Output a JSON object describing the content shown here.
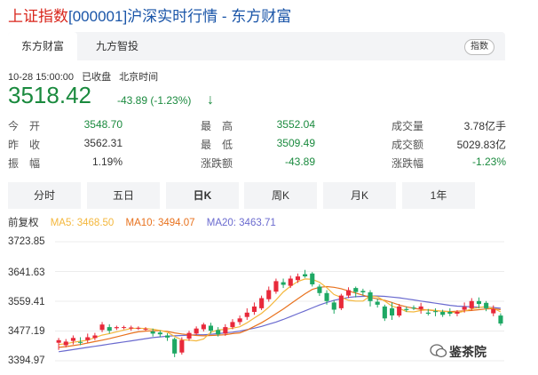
{
  "header": {
    "title_prefix": "上证指数",
    "title_code": "[000001]",
    "title_suffix": "沪深实时行情 - 东方财富"
  },
  "tabs": [
    {
      "label": "东方财富",
      "active": true
    },
    {
      "label": "九方智投",
      "active": false
    }
  ],
  "tag": "指数",
  "status": {
    "datetime": "10-28 15:00:00",
    "state": "已收盘",
    "tz": "北京时间"
  },
  "quote": {
    "price": "3518.42",
    "change": "-43.89 (-1.23%)",
    "arrow": "↓"
  },
  "stats": [
    {
      "label": "今　开",
      "value": "3548.70",
      "color": "g"
    },
    {
      "label": "最　高",
      "value": "3552.04",
      "color": "g"
    },
    {
      "label": "成交量",
      "value": "3.78亿手",
      "color": "k"
    },
    {
      "label": "昨　收",
      "value": "3562.31",
      "color": "k"
    },
    {
      "label": "最　低",
      "value": "3509.49",
      "color": "g"
    },
    {
      "label": "成交额",
      "value": "5029.83亿",
      "color": "k"
    },
    {
      "label": "振　幅",
      "value": "1.19%",
      "color": "k"
    },
    {
      "label": "涨跌额",
      "value": "-43.89",
      "color": "g"
    },
    {
      "label": "涨跌幅",
      "value": "-1.23%",
      "color": "g"
    }
  ],
  "periods": [
    {
      "label": "分时",
      "active": false
    },
    {
      "label": "五日",
      "active": false
    },
    {
      "label": "日K",
      "active": true
    },
    {
      "label": "周K",
      "active": false
    },
    {
      "label": "月K",
      "active": false
    },
    {
      "label": "1年",
      "active": false
    }
  ],
  "ma_legend": {
    "prefix": "前复权",
    "ma5": "MA5: 3468.50",
    "ma10": "MA10: 3494.07",
    "ma20": "MA20: 3463.71"
  },
  "colors": {
    "up": "#e8293a",
    "down": "#1ea864",
    "ma5": "#f4b73c",
    "ma10": "#e8721e",
    "ma20": "#6a6acf"
  },
  "watermark": "鉴茶院",
  "chart_data": {
    "type": "candlestick",
    "y_ticks": [
      "3723.85",
      "3641.63",
      "3559.41",
      "3477.19",
      "3394.97"
    ],
    "ylim": [
      3394.97,
      3723.85
    ],
    "grid": true,
    "candles": [
      [
        3445,
        3452,
        3425,
        3458
      ],
      [
        3438,
        3448,
        3432,
        3455
      ],
      [
        3450,
        3458,
        3440,
        3465
      ],
      [
        3447,
        3445,
        3438,
        3460
      ],
      [
        3452,
        3460,
        3445,
        3470
      ],
      [
        3458,
        3465,
        3452,
        3472
      ],
      [
        3480,
        3495,
        3474,
        3502
      ],
      [
        3488,
        3478,
        3470,
        3496
      ],
      [
        3485,
        3488,
        3480,
        3492
      ],
      [
        3486,
        3488,
        3482,
        3492
      ],
      [
        3484,
        3487,
        3478,
        3492
      ],
      [
        3484,
        3486,
        3480,
        3490
      ],
      [
        3482,
        3483,
        3478,
        3488
      ],
      [
        3476,
        3470,
        3462,
        3484
      ],
      [
        3473,
        3468,
        3460,
        3479
      ],
      [
        3465,
        3459,
        3450,
        3471
      ],
      [
        3455,
        3415,
        3405,
        3459
      ],
      [
        3418,
        3452,
        3412,
        3460
      ],
      [
        3456,
        3472,
        3450,
        3478
      ],
      [
        3470,
        3484,
        3466,
        3490
      ],
      [
        3482,
        3495,
        3476,
        3500
      ],
      [
        3492,
        3478,
        3470,
        3500
      ],
      [
        3480,
        3468,
        3462,
        3488
      ],
      [
        3470,
        3488,
        3464,
        3496
      ],
      [
        3488,
        3502,
        3482,
        3510
      ],
      [
        3502,
        3512,
        3494,
        3520
      ],
      [
        3516,
        3528,
        3508,
        3540
      ],
      [
        3530,
        3545,
        3522,
        3556
      ],
      [
        3540,
        3568,
        3535,
        3575
      ],
      [
        3565,
        3590,
        3558,
        3600
      ],
      [
        3586,
        3615,
        3580,
        3622
      ],
      [
        3612,
        3605,
        3596,
        3622
      ],
      [
        3602,
        3622,
        3596,
        3630
      ],
      [
        3618,
        3628,
        3610,
        3636
      ],
      [
        3634,
        3628,
        3624,
        3646
      ],
      [
        3636,
        3606,
        3600,
        3640
      ],
      [
        3600,
        3582,
        3574,
        3606
      ],
      [
        3582,
        3560,
        3550,
        3590
      ],
      [
        3556,
        3536,
        3525,
        3562
      ],
      [
        3540,
        3575,
        3535,
        3580
      ],
      [
        3575,
        3590,
        3568,
        3598
      ],
      [
        3596,
        3585,
        3570,
        3600
      ],
      [
        3588,
        3584,
        3575,
        3594
      ],
      [
        3584,
        3560,
        3545,
        3590
      ],
      [
        3558,
        3550,
        3542,
        3566
      ],
      [
        3545,
        3512,
        3505,
        3550
      ],
      [
        3540,
        3520,
        3508,
        3556
      ],
      [
        3520,
        3545,
        3515,
        3552
      ],
      [
        3538,
        3535,
        3530,
        3545
      ],
      [
        3542,
        3540,
        3535,
        3548
      ],
      [
        3538,
        3545,
        3525,
        3555
      ],
      [
        3528,
        3525,
        3520,
        3538
      ],
      [
        3532,
        3530,
        3518,
        3540
      ],
      [
        3530,
        3522,
        3516,
        3536
      ],
      [
        3530,
        3525,
        3518,
        3540
      ],
      [
        3525,
        3530,
        3518,
        3535
      ],
      [
        3536,
        3544,
        3528,
        3556
      ],
      [
        3540,
        3560,
        3534,
        3568
      ],
      [
        3560,
        3552,
        3540,
        3570
      ],
      [
        3555,
        3540,
        3532,
        3560
      ],
      [
        3526,
        3538,
        3518,
        3548
      ],
      [
        3520,
        3498,
        3492,
        3526
      ]
    ],
    "ma5": [
      3440,
      3442,
      3446,
      3449,
      3452,
      3459,
      3466,
      3470,
      3475,
      3480,
      3484,
      3485,
      3484,
      3482,
      3479,
      3474,
      3462,
      3453,
      3452,
      3450,
      3455,
      3474,
      3480,
      3482,
      3485,
      3489,
      3500,
      3513,
      3526,
      3543,
      3563,
      3585,
      3601,
      3614,
      3621,
      3620,
      3612,
      3597,
      3578,
      3570,
      3562,
      3560,
      3560,
      3574,
      3572,
      3560,
      3546,
      3540,
      3531,
      3530,
      3534,
      3536,
      3534,
      3532,
      3530,
      3527,
      3532,
      3538,
      3542,
      3545,
      3540,
      3530
    ],
    "ma10": [
      3432,
      3434,
      3437,
      3440,
      3444,
      3448,
      3452,
      3456,
      3461,
      3466,
      3471,
      3475,
      3477,
      3478,
      3478,
      3476,
      3472,
      3469,
      3467,
      3465,
      3464,
      3465,
      3466,
      3467,
      3470,
      3472,
      3480,
      3490,
      3500,
      3512,
      3525,
      3538,
      3552,
      3566,
      3580,
      3592,
      3598,
      3600,
      3598,
      3594,
      3588,
      3582,
      3576,
      3570,
      3566,
      3562,
      3556,
      3549,
      3544,
      3540,
      3537,
      3535,
      3533,
      3532,
      3531,
      3532,
      3533,
      3534,
      3536,
      3538,
      3539,
      3536
    ],
    "ma20": [
      3420,
      3423,
      3426,
      3429,
      3432,
      3435,
      3438,
      3441,
      3444,
      3447,
      3450,
      3453,
      3456,
      3459,
      3461,
      3463,
      3464,
      3465,
      3466,
      3467,
      3467,
      3468,
      3470,
      3472,
      3474,
      3477,
      3481,
      3485,
      3490,
      3496,
      3502,
      3509,
      3517,
      3525,
      3533,
      3541,
      3549,
      3556,
      3562,
      3566,
      3570,
      3572,
      3573,
      3574,
      3574,
      3573,
      3571,
      3569,
      3566,
      3563,
      3560,
      3557,
      3554,
      3551,
      3548,
      3546,
      3545,
      3544,
      3543,
      3543,
      3542,
      3540
    ]
  }
}
